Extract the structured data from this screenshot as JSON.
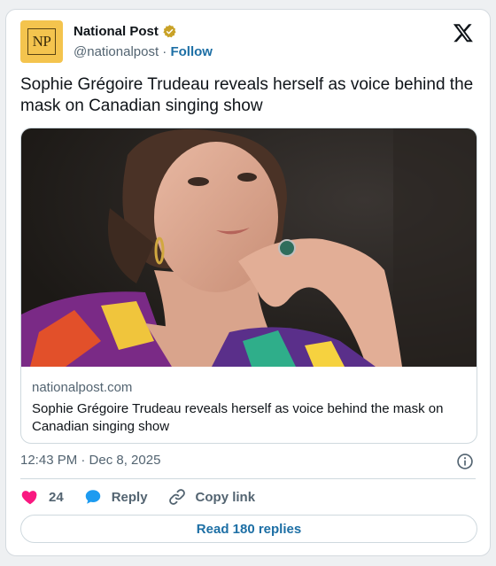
{
  "account": {
    "avatar_text": "NP",
    "display_name": "National Post",
    "handle": "@nationalpost",
    "separator": "·",
    "follow_label": "Follow",
    "verified_icon": "gold-verified-badge-icon"
  },
  "tweet": {
    "text": "Sophie Grégoire Trudeau reveals herself as voice behind the mask on Canadian singing show"
  },
  "link_card": {
    "domain": "nationalpost.com",
    "title": "Sophie Grégoire Trudeau reveals herself as voice behind the mask on Canadian singing show",
    "image_description_icon": "article-photo"
  },
  "meta": {
    "timestamp": "12:43 PM · Dec 8, 2025"
  },
  "actions": {
    "like_count": "24",
    "reply_label": "Reply",
    "copy_link_label": "Copy link"
  },
  "footer": {
    "read_replies_label": "Read 180 replies"
  },
  "colors": {
    "accent": "#1d6fa5",
    "like": "#f91880",
    "reply": "#1d9bf0",
    "avatar_bg": "#f4c44e"
  }
}
